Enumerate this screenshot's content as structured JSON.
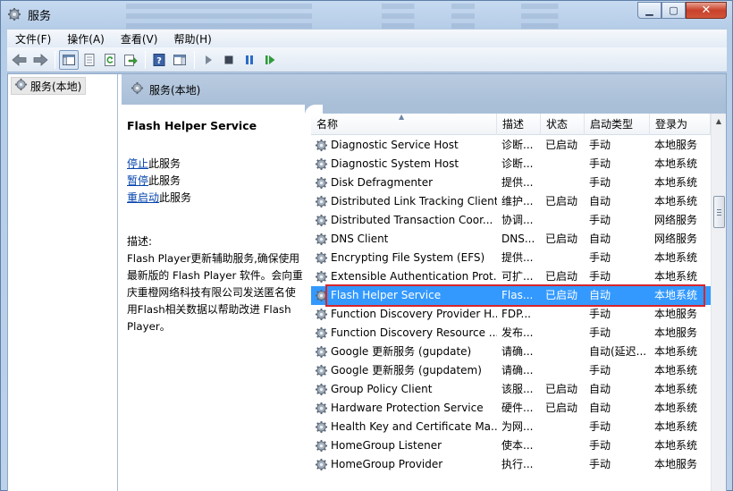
{
  "window": {
    "title": "服务"
  },
  "menu": [
    "文件(F)",
    "操作(A)",
    "查看(V)",
    "帮助(H)"
  ],
  "tree": {
    "item_label": "服务(本地)"
  },
  "pane": {
    "header_title": "服务(本地)"
  },
  "details": {
    "service_title": "Flash Helper Service",
    "actions": [
      {
        "link": "停止",
        "suffix": "此服务"
      },
      {
        "link": "暂停",
        "suffix": "此服务"
      },
      {
        "link": "重启动",
        "suffix": "此服务"
      }
    ],
    "description_label": "描述:",
    "description_lines": [
      "Flash Player更新辅助服务,确保使用",
      "最新版的 Flash Player 软件。会向重",
      "庆重橙网络科技有限公司发送匿名使",
      "用Flash相关数据以帮助改进 Flash",
      "Player。"
    ]
  },
  "table": {
    "columns": [
      "名称",
      "描述",
      "状态",
      "启动类型",
      "登录为"
    ],
    "rows": [
      {
        "name": "Diagnostic Service Host",
        "desc": "诊断...",
        "status": "已启动",
        "startup": "手动",
        "logon": "本地服务"
      },
      {
        "name": "Diagnostic System Host",
        "desc": "诊断...",
        "status": "",
        "startup": "手动",
        "logon": "本地系统"
      },
      {
        "name": "Disk Defragmenter",
        "desc": "提供...",
        "status": "",
        "startup": "手动",
        "logon": "本地系统"
      },
      {
        "name": "Distributed Link Tracking Client",
        "desc": "维护...",
        "status": "已启动",
        "startup": "自动",
        "logon": "本地系统"
      },
      {
        "name": "Distributed Transaction Coor...",
        "desc": "协调...",
        "status": "",
        "startup": "手动",
        "logon": "网络服务"
      },
      {
        "name": "DNS Client",
        "desc": "DNS...",
        "status": "已启动",
        "startup": "自动",
        "logon": "网络服务"
      },
      {
        "name": "Encrypting File System (EFS)",
        "desc": "提供...",
        "status": "",
        "startup": "手动",
        "logon": "本地系统"
      },
      {
        "name": "Extensible Authentication Prot...",
        "desc": "可扩...",
        "status": "已启动",
        "startup": "手动",
        "logon": "本地系统"
      },
      {
        "name": "Flash Helper Service",
        "desc": "Flas...",
        "status": "已启动",
        "startup": "自动",
        "logon": "本地系统",
        "selected": true
      },
      {
        "name": "Function Discovery Provider H...",
        "desc": "FDP...",
        "status": "",
        "startup": "手动",
        "logon": "本地服务"
      },
      {
        "name": "Function Discovery Resource ...",
        "desc": "发布...",
        "status": "",
        "startup": "手动",
        "logon": "本地服务"
      },
      {
        "name": "Google 更新服务 (gupdate)",
        "desc": "请确...",
        "status": "",
        "startup": "自动(延迟...",
        "logon": "本地系统"
      },
      {
        "name": "Google 更新服务 (gupdatem)",
        "desc": "请确...",
        "status": "",
        "startup": "手动",
        "logon": "本地系统"
      },
      {
        "name": "Group Policy Client",
        "desc": "该服...",
        "status": "已启动",
        "startup": "自动",
        "logon": "本地系统"
      },
      {
        "name": "Hardware Protection Service",
        "desc": "硬件...",
        "status": "已启动",
        "startup": "自动",
        "logon": "本地系统"
      },
      {
        "name": "Health Key and Certificate Ma...",
        "desc": "为网...",
        "status": "",
        "startup": "手动",
        "logon": "本地系统"
      },
      {
        "name": "HomeGroup Listener",
        "desc": "使本...",
        "status": "",
        "startup": "手动",
        "logon": "本地系统"
      },
      {
        "name": "HomeGroup Provider",
        "desc": "执行...",
        "status": "",
        "startup": "手动",
        "logon": "本地服务"
      }
    ]
  },
  "colors": {
    "selection": "#3399ff",
    "highlight_border": "#d6252c",
    "link": "#0645ad"
  },
  "icons": {
    "service": "gear-icon"
  }
}
